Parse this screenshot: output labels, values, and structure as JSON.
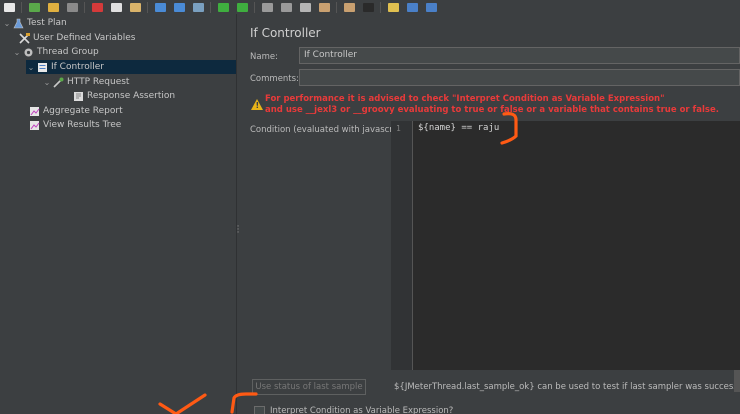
{
  "toolbar": {
    "buttons": [
      {
        "name": "new-icon",
        "color": "#e8e8e8"
      },
      {
        "name": "templates-icon",
        "color": "#5aa94a"
      },
      {
        "name": "open-icon",
        "color": "#e0b040"
      },
      {
        "name": "save-icon",
        "color": "#8a8a8a"
      },
      {
        "name": "cut-icon",
        "color": "#d43a3a"
      },
      {
        "name": "copy-icon",
        "color": "#e0e0e0"
      },
      {
        "name": "paste-icon",
        "color": "#d9b36a"
      },
      {
        "name": "expand-icon",
        "color": "#4a8bd6"
      },
      {
        "name": "collapse-icon",
        "color": "#4a8bd6"
      },
      {
        "name": "toggle-icon",
        "color": "#7aa0c0"
      },
      {
        "name": "start-icon",
        "color": "#3fae3f"
      },
      {
        "name": "start-no-pauses-icon",
        "color": "#3fae3f"
      },
      {
        "name": "stop-icon",
        "color": "#9a9a9a"
      },
      {
        "name": "shutdown-icon",
        "color": "#9a9a9a"
      },
      {
        "name": "remote-icon",
        "color": "#b5b5b5"
      },
      {
        "name": "clear-icon",
        "color": "#c9a070"
      },
      {
        "name": "clear-all-icon",
        "color": "#c9a070"
      },
      {
        "name": "search-icon",
        "color": "#2a2a2a"
      },
      {
        "name": "reset-search-icon",
        "color": "#e0c050"
      },
      {
        "name": "function-helper-icon",
        "color": "#4a80c8"
      },
      {
        "name": "help-icon",
        "color": "#4a80c8"
      }
    ]
  },
  "tree": {
    "items": [
      {
        "label": "Test Plan"
      },
      {
        "label": "User Defined Variables"
      },
      {
        "label": "Thread Group"
      },
      {
        "label": "If Controller"
      },
      {
        "label": "HTTP Request"
      },
      {
        "label": "Response Assertion"
      },
      {
        "label": "Aggregate Report"
      },
      {
        "label": "View Results Tree"
      }
    ]
  },
  "panel": {
    "title": "If Controller",
    "name_label": "Name:",
    "name_value": "If Controller",
    "comments_label": "Comments:",
    "comments_value": "",
    "warning_line1": "For performance it is advised to check \"Interpret Condition as Variable Expression\"",
    "warning_line2": "and use __jexl3 or __groovy evaluating to true or false or a variable that contains true or false.",
    "condition_label": "Condition (evaluated with javascript)",
    "line_number": "1",
    "condition_code": "${name} == raju",
    "use_status_button": "Use status of last sample",
    "hint": "${JMeterThread.last_sample_ok} can be used to test if last sampler was successful",
    "interpret_checkbox_label": "Interpret Condition as Variable Expression?",
    "interpret_checked": false
  },
  "annotation_color": "#ff5a14"
}
